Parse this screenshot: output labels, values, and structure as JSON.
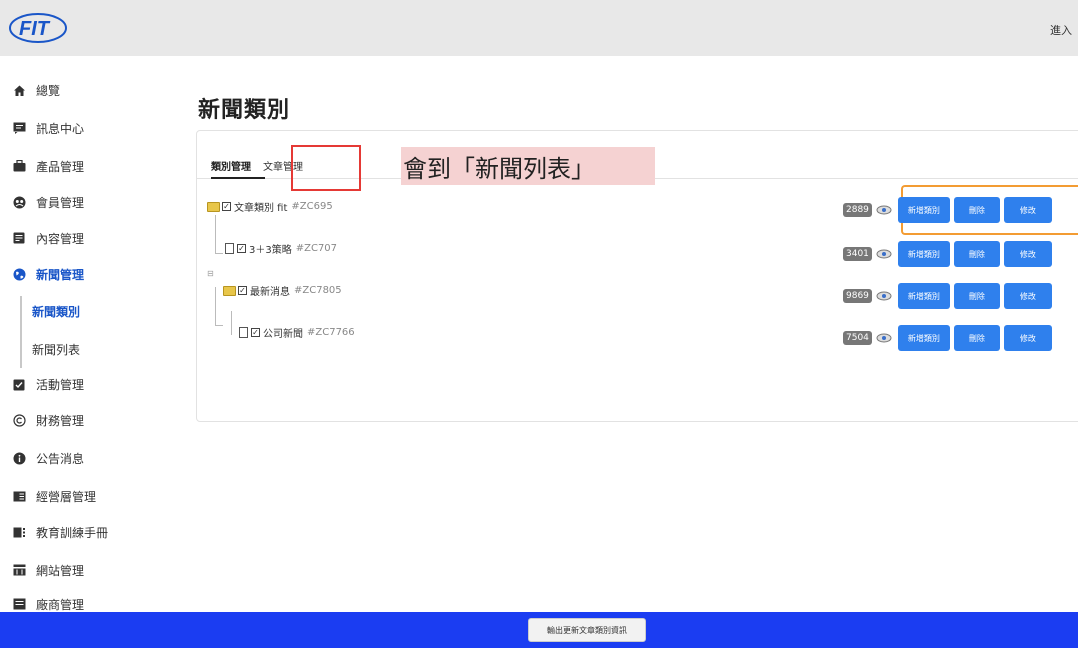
{
  "header": {
    "logo_text": "FIT",
    "right_link": "進入"
  },
  "sidebar": {
    "items": [
      {
        "label": "總覽",
        "icon": "home-icon"
      },
      {
        "label": "訊息中心",
        "icon": "message-icon"
      },
      {
        "label": "產品管理",
        "icon": "briefcase-icon"
      },
      {
        "label": "會員管理",
        "icon": "member-icon"
      },
      {
        "label": "內容管理",
        "icon": "content-icon"
      },
      {
        "label": "新聞管理",
        "icon": "globe-icon"
      },
      {
        "label": "活動管理",
        "icon": "clipboard-icon"
      },
      {
        "label": "財務管理",
        "icon": "copyright-icon"
      },
      {
        "label": "公告消息",
        "icon": "info-icon"
      },
      {
        "label": "經營層管理",
        "icon": "panel-icon"
      },
      {
        "label": "教育訓練手冊",
        "icon": "manual-icon"
      },
      {
        "label": "網站管理",
        "icon": "website-icon"
      },
      {
        "label": "廠商管理",
        "icon": "vendor-icon"
      }
    ],
    "sub_items": [
      {
        "label": "新聞類別"
      },
      {
        "label": "新聞列表"
      }
    ]
  },
  "main": {
    "title": "新聞類別",
    "tabs": [
      {
        "label": "類別管理"
      },
      {
        "label": "文章管理"
      }
    ],
    "annotation": "會到「新聞列表」",
    "tree": [
      {
        "label": "文章類別 fit",
        "id": "#ZC695",
        "count": "2889"
      },
      {
        "label": "3＋3策略",
        "id": "#ZC707",
        "count": "3401"
      },
      {
        "label": "最新消息",
        "id": "#ZC7805",
        "count": "9869"
      },
      {
        "label": "公司新聞",
        "id": "#ZC7766",
        "count": "7504"
      }
    ],
    "buttons": {
      "add": "新增類別",
      "delete": "刪除",
      "edit": "修改"
    }
  },
  "footer": {
    "export_button": "輸出更新文章類別資訊"
  },
  "colors": {
    "accent": "#2f80ed",
    "active_nav": "#1a56c8",
    "bottom_bar": "#1b3df2",
    "highlight_red": "#e53935",
    "highlight_orange": "#f39c33",
    "annotation_bg": "#f5d2d2"
  }
}
